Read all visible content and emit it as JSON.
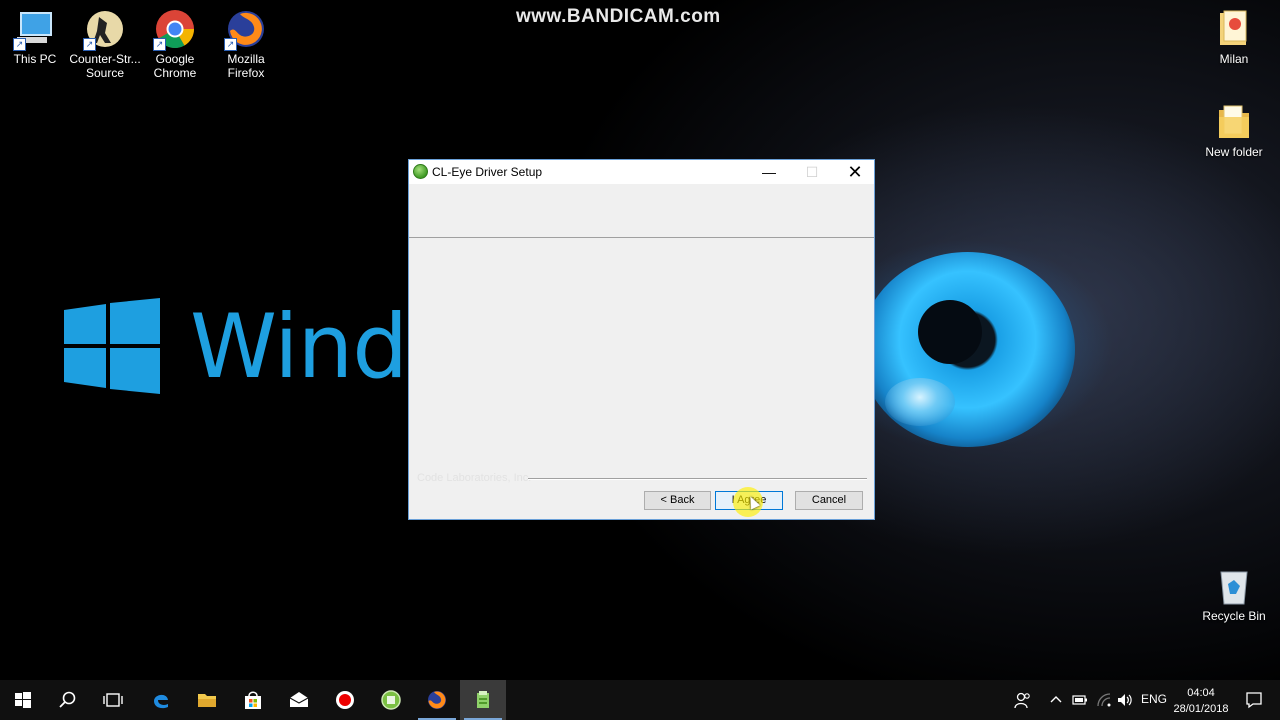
{
  "watermark": "www.BANDICAM.com",
  "wallpaper_text": "Windo",
  "desktop_icons": [
    {
      "label": "This PC",
      "icon": "computer-icon"
    },
    {
      "label": "Counter-Str... Source",
      "icon": "counter-strike-icon"
    },
    {
      "label": "Google Chrome",
      "icon": "chrome-icon"
    },
    {
      "label": "Mozilla Firefox",
      "icon": "firefox-icon"
    },
    {
      "label": "Milan",
      "icon": "user-folder-icon"
    },
    {
      "label": "New folder",
      "icon": "folder-icon"
    },
    {
      "label": "Recycle Bin",
      "icon": "recycle-bin-icon"
    }
  ],
  "dialog": {
    "title": "CL-Eye Driver Setup",
    "branding": "Code Laboratories, Inc.",
    "buttons": {
      "back": "< Back",
      "agree": "I Agree",
      "cancel": "Cancel"
    },
    "controls": {
      "minimize": "—",
      "maximize": "☐",
      "close": "✕"
    }
  },
  "taskbar": {
    "items": [
      "start-icon",
      "search-icon",
      "task-view-icon",
      "edge-icon",
      "file-explorer-icon",
      "store-icon",
      "mail-icon",
      "bandicam-record-icon",
      "app-green-icon",
      "firefox-icon",
      "installer-icon"
    ],
    "language": "ENG",
    "time": "04:04",
    "date": "28/01/2018"
  },
  "colors": {
    "windows_blue": "#1e9fe0",
    "dialog_bg": "#f0f0f0",
    "accent": "#0078d7",
    "taskbar_bg": "#101010"
  }
}
